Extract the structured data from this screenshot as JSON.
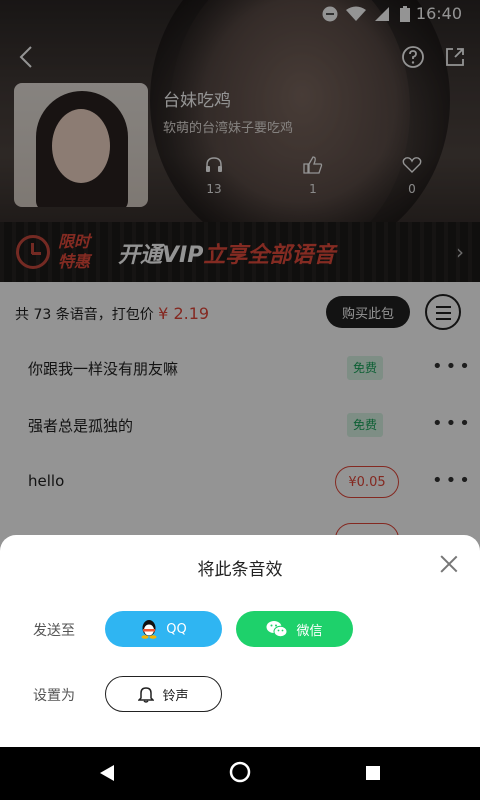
{
  "status": {
    "time": "16:40"
  },
  "album": {
    "title": "台妹吃鸡",
    "subtitle": "软萌的台湾妹子要吃鸡",
    "stats": {
      "listens": "13",
      "likes": "1",
      "favorites": "0"
    }
  },
  "vip_banner": {
    "limit_line1": "限时",
    "limit_line2": "特惠",
    "promo_white": "开通VIP",
    "promo_red": "立享全部语音"
  },
  "pack": {
    "text": "共 73 条语音，打包价",
    "price": "¥ 2.19",
    "buy_label": "购买此包"
  },
  "voices": [
    {
      "name": "你跟我一样没有朋友嘛",
      "tag": "免费"
    },
    {
      "name": "强者总是孤独的",
      "tag": "免费"
    },
    {
      "name": "hello",
      "price": "¥0.05"
    }
  ],
  "sheet": {
    "title": "将此条音效",
    "send_to_label": "发送至",
    "qq_label": "QQ",
    "wechat_label": "微信",
    "set_as_label": "设置为",
    "ringtone_label": "铃声"
  },
  "colors": {
    "accent_red": "#e4473a",
    "qq_blue": "#2fb5f2",
    "wechat_green": "#1ed16b",
    "free_green": "#18a55b"
  }
}
